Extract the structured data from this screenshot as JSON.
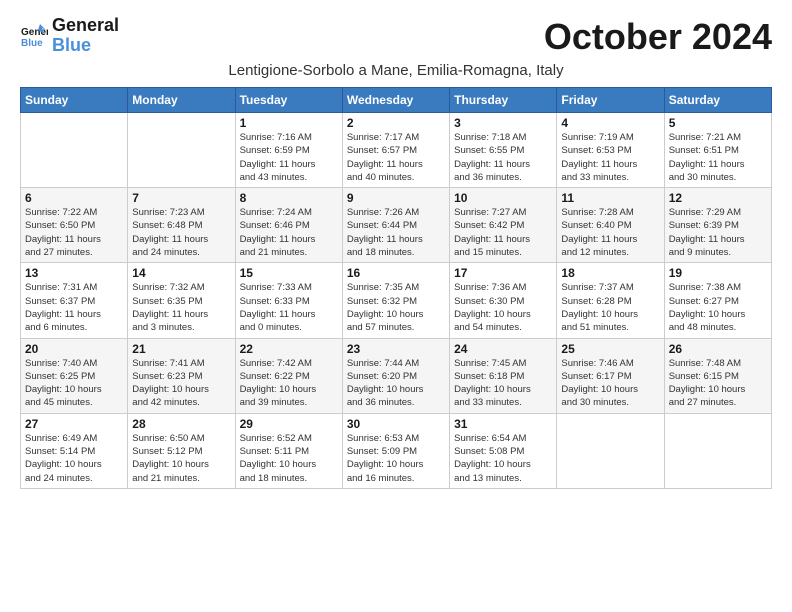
{
  "header": {
    "logo_line1": "General",
    "logo_line2": "Blue",
    "month_title": "October 2024",
    "location": "Lentigione-Sorbolo a Mane, Emilia-Romagna, Italy"
  },
  "weekdays": [
    "Sunday",
    "Monday",
    "Tuesday",
    "Wednesday",
    "Thursday",
    "Friday",
    "Saturday"
  ],
  "weeks": [
    [
      {
        "day": "",
        "info": ""
      },
      {
        "day": "",
        "info": ""
      },
      {
        "day": "1",
        "info": "Sunrise: 7:16 AM\nSunset: 6:59 PM\nDaylight: 11 hours\nand 43 minutes."
      },
      {
        "day": "2",
        "info": "Sunrise: 7:17 AM\nSunset: 6:57 PM\nDaylight: 11 hours\nand 40 minutes."
      },
      {
        "day": "3",
        "info": "Sunrise: 7:18 AM\nSunset: 6:55 PM\nDaylight: 11 hours\nand 36 minutes."
      },
      {
        "day": "4",
        "info": "Sunrise: 7:19 AM\nSunset: 6:53 PM\nDaylight: 11 hours\nand 33 minutes."
      },
      {
        "day": "5",
        "info": "Sunrise: 7:21 AM\nSunset: 6:51 PM\nDaylight: 11 hours\nand 30 minutes."
      }
    ],
    [
      {
        "day": "6",
        "info": "Sunrise: 7:22 AM\nSunset: 6:50 PM\nDaylight: 11 hours\nand 27 minutes."
      },
      {
        "day": "7",
        "info": "Sunrise: 7:23 AM\nSunset: 6:48 PM\nDaylight: 11 hours\nand 24 minutes."
      },
      {
        "day": "8",
        "info": "Sunrise: 7:24 AM\nSunset: 6:46 PM\nDaylight: 11 hours\nand 21 minutes."
      },
      {
        "day": "9",
        "info": "Sunrise: 7:26 AM\nSunset: 6:44 PM\nDaylight: 11 hours\nand 18 minutes."
      },
      {
        "day": "10",
        "info": "Sunrise: 7:27 AM\nSunset: 6:42 PM\nDaylight: 11 hours\nand 15 minutes."
      },
      {
        "day": "11",
        "info": "Sunrise: 7:28 AM\nSunset: 6:40 PM\nDaylight: 11 hours\nand 12 minutes."
      },
      {
        "day": "12",
        "info": "Sunrise: 7:29 AM\nSunset: 6:39 PM\nDaylight: 11 hours\nand 9 minutes."
      }
    ],
    [
      {
        "day": "13",
        "info": "Sunrise: 7:31 AM\nSunset: 6:37 PM\nDaylight: 11 hours\nand 6 minutes."
      },
      {
        "day": "14",
        "info": "Sunrise: 7:32 AM\nSunset: 6:35 PM\nDaylight: 11 hours\nand 3 minutes."
      },
      {
        "day": "15",
        "info": "Sunrise: 7:33 AM\nSunset: 6:33 PM\nDaylight: 11 hours\nand 0 minutes."
      },
      {
        "day": "16",
        "info": "Sunrise: 7:35 AM\nSunset: 6:32 PM\nDaylight: 10 hours\nand 57 minutes."
      },
      {
        "day": "17",
        "info": "Sunrise: 7:36 AM\nSunset: 6:30 PM\nDaylight: 10 hours\nand 54 minutes."
      },
      {
        "day": "18",
        "info": "Sunrise: 7:37 AM\nSunset: 6:28 PM\nDaylight: 10 hours\nand 51 minutes."
      },
      {
        "day": "19",
        "info": "Sunrise: 7:38 AM\nSunset: 6:27 PM\nDaylight: 10 hours\nand 48 minutes."
      }
    ],
    [
      {
        "day": "20",
        "info": "Sunrise: 7:40 AM\nSunset: 6:25 PM\nDaylight: 10 hours\nand 45 minutes."
      },
      {
        "day": "21",
        "info": "Sunrise: 7:41 AM\nSunset: 6:23 PM\nDaylight: 10 hours\nand 42 minutes."
      },
      {
        "day": "22",
        "info": "Sunrise: 7:42 AM\nSunset: 6:22 PM\nDaylight: 10 hours\nand 39 minutes."
      },
      {
        "day": "23",
        "info": "Sunrise: 7:44 AM\nSunset: 6:20 PM\nDaylight: 10 hours\nand 36 minutes."
      },
      {
        "day": "24",
        "info": "Sunrise: 7:45 AM\nSunset: 6:18 PM\nDaylight: 10 hours\nand 33 minutes."
      },
      {
        "day": "25",
        "info": "Sunrise: 7:46 AM\nSunset: 6:17 PM\nDaylight: 10 hours\nand 30 minutes."
      },
      {
        "day": "26",
        "info": "Sunrise: 7:48 AM\nSunset: 6:15 PM\nDaylight: 10 hours\nand 27 minutes."
      }
    ],
    [
      {
        "day": "27",
        "info": "Sunrise: 6:49 AM\nSunset: 5:14 PM\nDaylight: 10 hours\nand 24 minutes."
      },
      {
        "day": "28",
        "info": "Sunrise: 6:50 AM\nSunset: 5:12 PM\nDaylight: 10 hours\nand 21 minutes."
      },
      {
        "day": "29",
        "info": "Sunrise: 6:52 AM\nSunset: 5:11 PM\nDaylight: 10 hours\nand 18 minutes."
      },
      {
        "day": "30",
        "info": "Sunrise: 6:53 AM\nSunset: 5:09 PM\nDaylight: 10 hours\nand 16 minutes."
      },
      {
        "day": "31",
        "info": "Sunrise: 6:54 AM\nSunset: 5:08 PM\nDaylight: 10 hours\nand 13 minutes."
      },
      {
        "day": "",
        "info": ""
      },
      {
        "day": "",
        "info": ""
      }
    ]
  ]
}
